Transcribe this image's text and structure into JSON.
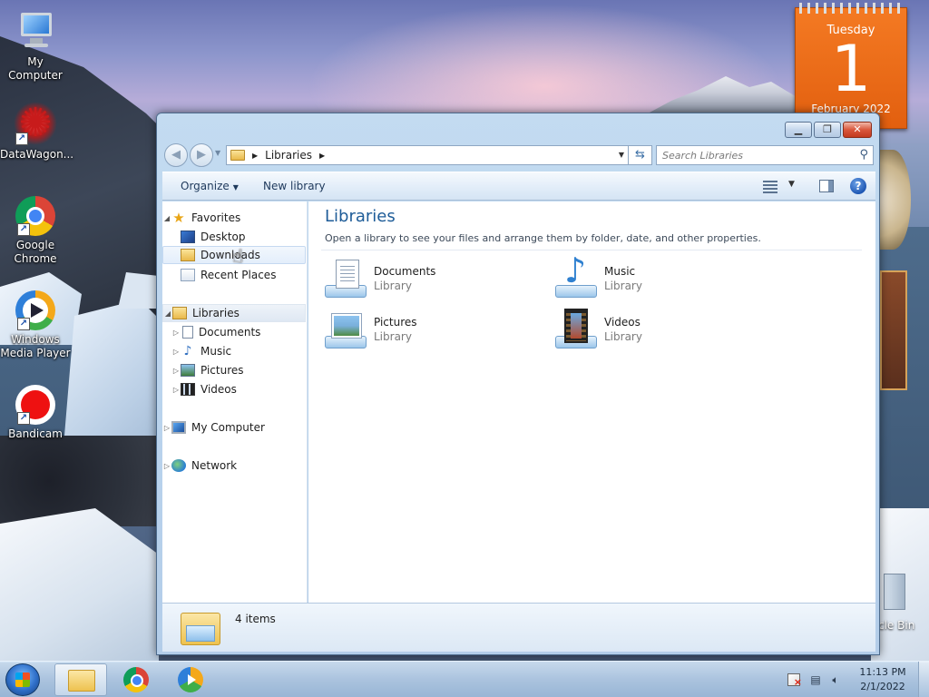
{
  "desktop": {
    "icons": [
      {
        "label": "My Computer",
        "icon": "computer-icon"
      },
      {
        "label": "DataWagon...",
        "icon": "datawagon-icon"
      },
      {
        "label": "Google Chrome",
        "icon": "chrome-icon"
      },
      {
        "label": "Windows Media Player",
        "icon": "media-player-icon"
      },
      {
        "label": "Bandicam",
        "icon": "bandicam-icon"
      }
    ],
    "recycle_bin_label": "cle Bin"
  },
  "calendar_gadget": {
    "weekday": "Tuesday",
    "day": "1",
    "month_year": "February 2022"
  },
  "window": {
    "address": {
      "crumb": "Libraries"
    },
    "search": {
      "placeholder": "Search Libraries"
    },
    "toolbar": {
      "organize": "Organize",
      "new_library": "New library"
    },
    "nav_pane": {
      "favorites": "Favorites",
      "favorites_items": [
        "Desktop",
        "Downloads",
        "Recent Places"
      ],
      "libraries": "Libraries",
      "libraries_items": [
        "Documents",
        "Music",
        "Pictures",
        "Videos"
      ],
      "my_computer": "My Computer",
      "network": "Network"
    },
    "content": {
      "title": "Libraries",
      "subtitle": "Open a library to see your files and arrange them by folder, date, and other properties.",
      "items": [
        {
          "name": "Documents",
          "type": "Library",
          "icon": "documents-library-icon"
        },
        {
          "name": "Music",
          "type": "Library",
          "icon": "music-library-icon"
        },
        {
          "name": "Pictures",
          "type": "Library",
          "icon": "pictures-library-icon"
        },
        {
          "name": "Videos",
          "type": "Library",
          "icon": "videos-library-icon"
        }
      ]
    },
    "details": {
      "count": "4 items"
    }
  },
  "taskbar": {
    "time": "11:13 PM",
    "date": "2/1/2022"
  }
}
